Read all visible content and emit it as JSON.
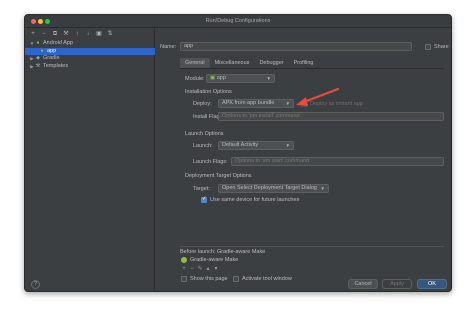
{
  "window": {
    "title": "Run/Debug Configurations"
  },
  "left_toolbar": {
    "icons": [
      "add-icon",
      "remove-icon",
      "copy-icon",
      "wrench-icon",
      "arrow-up-icon",
      "arrow-down-icon",
      "folder-icon",
      "sort-icon"
    ],
    "glyphs": [
      "+",
      "−",
      "⧉",
      "⚒",
      "↑",
      "↓",
      "▣",
      "⇅"
    ]
  },
  "tree": {
    "android_app": "Android App",
    "app": "app",
    "gradle": "Gradle",
    "templates": "Templates"
  },
  "config": {
    "name_label": "Name:",
    "name_value": "app",
    "share_label": "Share"
  },
  "tabs": [
    "General",
    "Miscellaneous",
    "Debugger",
    "Profiling"
  ],
  "general": {
    "module_label": "Module:",
    "module_value": "app",
    "installation_header": "Installation Options",
    "deploy_label": "Deploy:",
    "deploy_value": "APK from app bundle",
    "instant_app_label": "Deploy as instant app",
    "install_flags_label": "Install Flags:",
    "install_flags_placeholder": "Options to 'pm install' command",
    "launch_header": "Launch Options",
    "launch_label": "Launch:",
    "launch_value": "Default Activity",
    "launch_flags_label": "Launch Flags:",
    "launch_flags_placeholder": "Options to 'am start' command",
    "target_header": "Deployment Target Options",
    "target_label": "Target:",
    "target_value": "Open Select Deployment Target Dialog",
    "same_device_label": "Use same device for future launches"
  },
  "before_launch": {
    "header": "Before launch: Gradle-aware Make",
    "item": "Gradle-aware Make",
    "show_page_label": "Show this page",
    "activate_window_label": "Activate tool window"
  },
  "buttons": {
    "help": "?",
    "cancel": "Cancel",
    "apply": "Apply",
    "ok": "OK"
  },
  "colors": {
    "accent": "#2f65ca",
    "arrow": "#e84c3d",
    "background": "#3c3f41"
  }
}
